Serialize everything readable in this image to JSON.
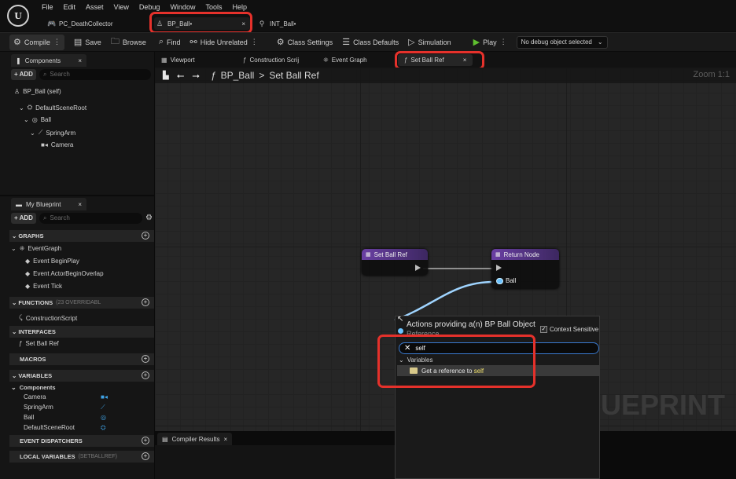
{
  "menu": [
    "File",
    "Edit",
    "Asset",
    "View",
    "Debug",
    "Window",
    "Tools",
    "Help"
  ],
  "logo_text": "U",
  "doc_tabs": [
    {
      "label": "PC_DeathCollector",
      "icon": "gamepad-icon"
    },
    {
      "label": "BP_Ball•",
      "icon": "actor-icon"
    },
    {
      "label": "INT_Ball•",
      "icon": "interface-icon"
    }
  ],
  "toolbar": {
    "compile": "Compile",
    "save": "Save",
    "browse": "Browse",
    "find": "Find",
    "hide_unrelated": "Hide Unrelated",
    "class_settings": "Class Settings",
    "class_defaults": "Class Defaults",
    "simulation": "Simulation",
    "play": "Play",
    "debug_object": "No debug object selected"
  },
  "components": {
    "tab": "Components",
    "add": "+ ADD",
    "search_placeholder": "Search",
    "self": "BP_Ball (self)",
    "tree": [
      "DefaultSceneRoot",
      "Ball",
      "SpringArm",
      "Camera"
    ]
  },
  "myblueprint": {
    "tab": "My Blueprint",
    "add": "+ ADD",
    "search_placeholder": "Search",
    "graphs_header": "GRAPHS",
    "event_graph": "EventGraph",
    "events": [
      "Event BeginPlay",
      "Event ActorBeginOverlap",
      "Event Tick"
    ],
    "functions_header": "FUNCTIONS",
    "functions_sub": "(23 OVERRIDABL",
    "construction_script": "ConstructionScript",
    "interfaces_header": "INTERFACES",
    "interface_fn": "Set Ball Ref",
    "macros_header": "MACROS",
    "variables_header": "VARIABLES",
    "components_group": "Components",
    "variables": [
      "Camera",
      "SpringArm",
      "Ball",
      "DefaultSceneRoot"
    ],
    "dispatchers_header": "EVENT DISPATCHERS",
    "local_vars_header": "LOCAL VARIABLES",
    "local_vars_sub": "(SETBALLREF)"
  },
  "editor_tabs": [
    "Viewport",
    "Construction Scrij",
    "Event Graph",
    "Set Ball Ref"
  ],
  "graph": {
    "crumb_root": "BP_Ball",
    "crumb_sep": ">",
    "crumb_leaf": "Set Ball Ref",
    "zoom": "Zoom 1:1",
    "watermark": "LUEPRINT",
    "node_set_title": "Set Ball Ref",
    "node_return_title": "Return Node",
    "return_pin": "Ball"
  },
  "action_menu": {
    "title": "Actions providing a(n) BP Ball Object",
    "subtitle": "Reference",
    "context_sensitive": "Context Sensitive",
    "search_value": "self",
    "category": "Variables",
    "item_prefix": "Get a reference to ",
    "item_highlight": "self"
  },
  "compiler": {
    "tab": "Compiler Results"
  },
  "colors": {
    "highlight_box": "#e5312b",
    "node_header": "#6a3fa3",
    "object_pin": "#6cc3ff",
    "play_green": "#5fbf2f"
  }
}
